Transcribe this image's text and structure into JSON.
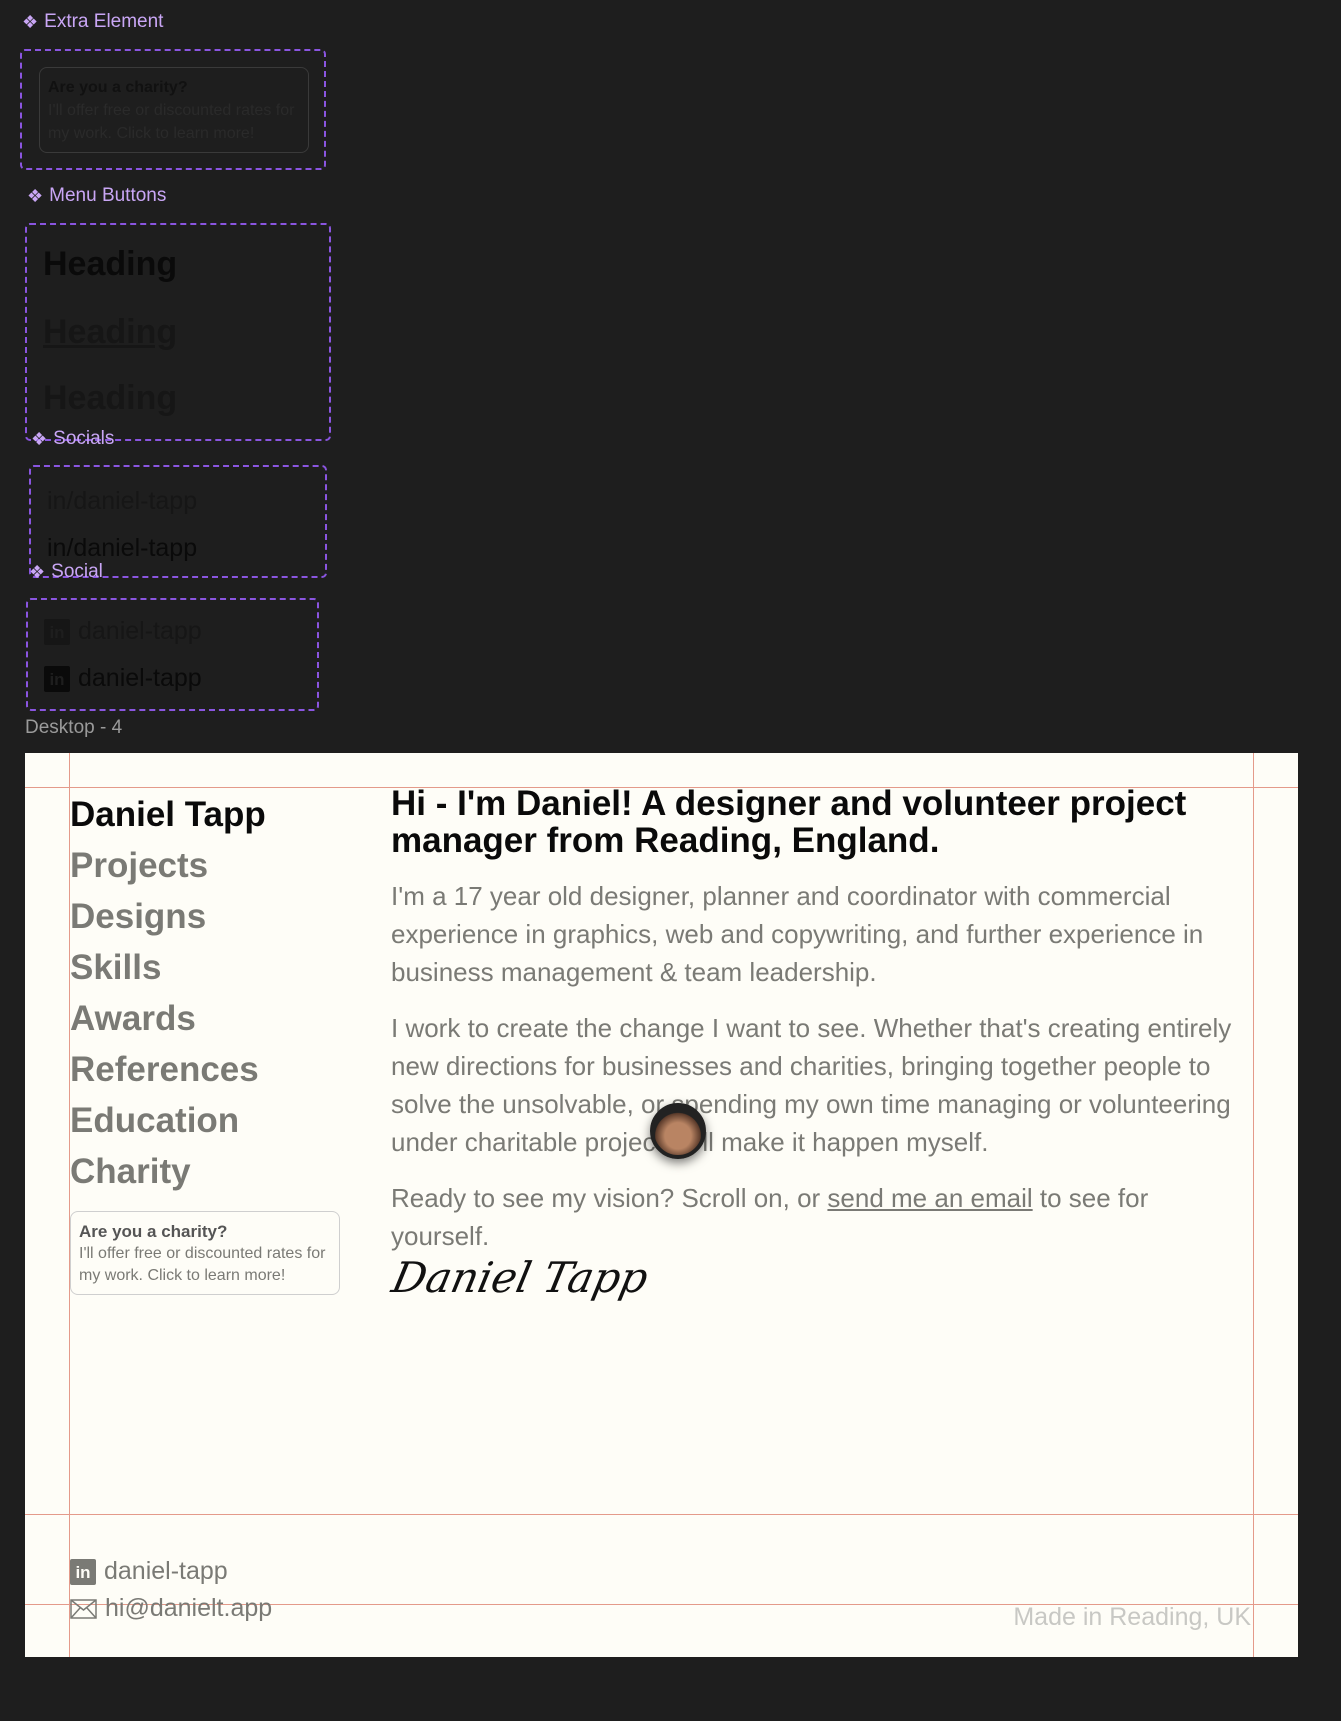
{
  "canvas": {
    "extra_element": {
      "label": "Extra Element",
      "title": "Are you a charity?",
      "text": "I'll offer free or discounted rates for my work. Click to learn more!"
    },
    "menu_buttons": {
      "label": "Menu Buttons",
      "items": [
        "Heading",
        "Heading",
        "Heading"
      ]
    },
    "socials": {
      "label": "Socials",
      "items": [
        "in/daniel-tapp",
        "in/daniel-tapp"
      ]
    },
    "social": {
      "label": "Social",
      "items": [
        "daniel-tapp",
        "daniel-tapp"
      ]
    },
    "frame_label": "Desktop - 4"
  },
  "page": {
    "name": "Daniel Tapp",
    "nav": [
      "Projects",
      "Designs",
      "Skills",
      "Awards",
      "References",
      "Education",
      "Charity"
    ],
    "charity_card": {
      "title": "Are you a charity?",
      "text": "I'll offer free or discounted rates for my work. Click to learn more!"
    },
    "heading": "Hi - I'm Daniel! A designer and volunteer project manager from Reading, England.",
    "paragraphs": [
      "I'm a 17 year old designer, planner and coordinator with commercial experience in graphics, web and copywriting, and further experience in business management & team leadership.",
      "I work to create the change I want to see. Whether that's creating entirely new directions for businesses and charities, bringing together people to solve the unsolvable, or spending my own time managing or volunteering under charitable projects, I'll make it happen myself."
    ],
    "cta": {
      "before": "Ready to see my vision? Scroll on, or ",
      "link": "send me an email",
      "after": " to see for yourself."
    },
    "signature": "Daniel Tapp",
    "footer": {
      "linkedin": "daniel-tapp",
      "email": "hi@danielt.app",
      "made_in": "Made in Reading, UK"
    }
  },
  "colors": {
    "accent": "#8a55e0",
    "page_bg": "#fefdf7",
    "guide": "#e49a8a",
    "muted_text": "#7a7a75"
  }
}
